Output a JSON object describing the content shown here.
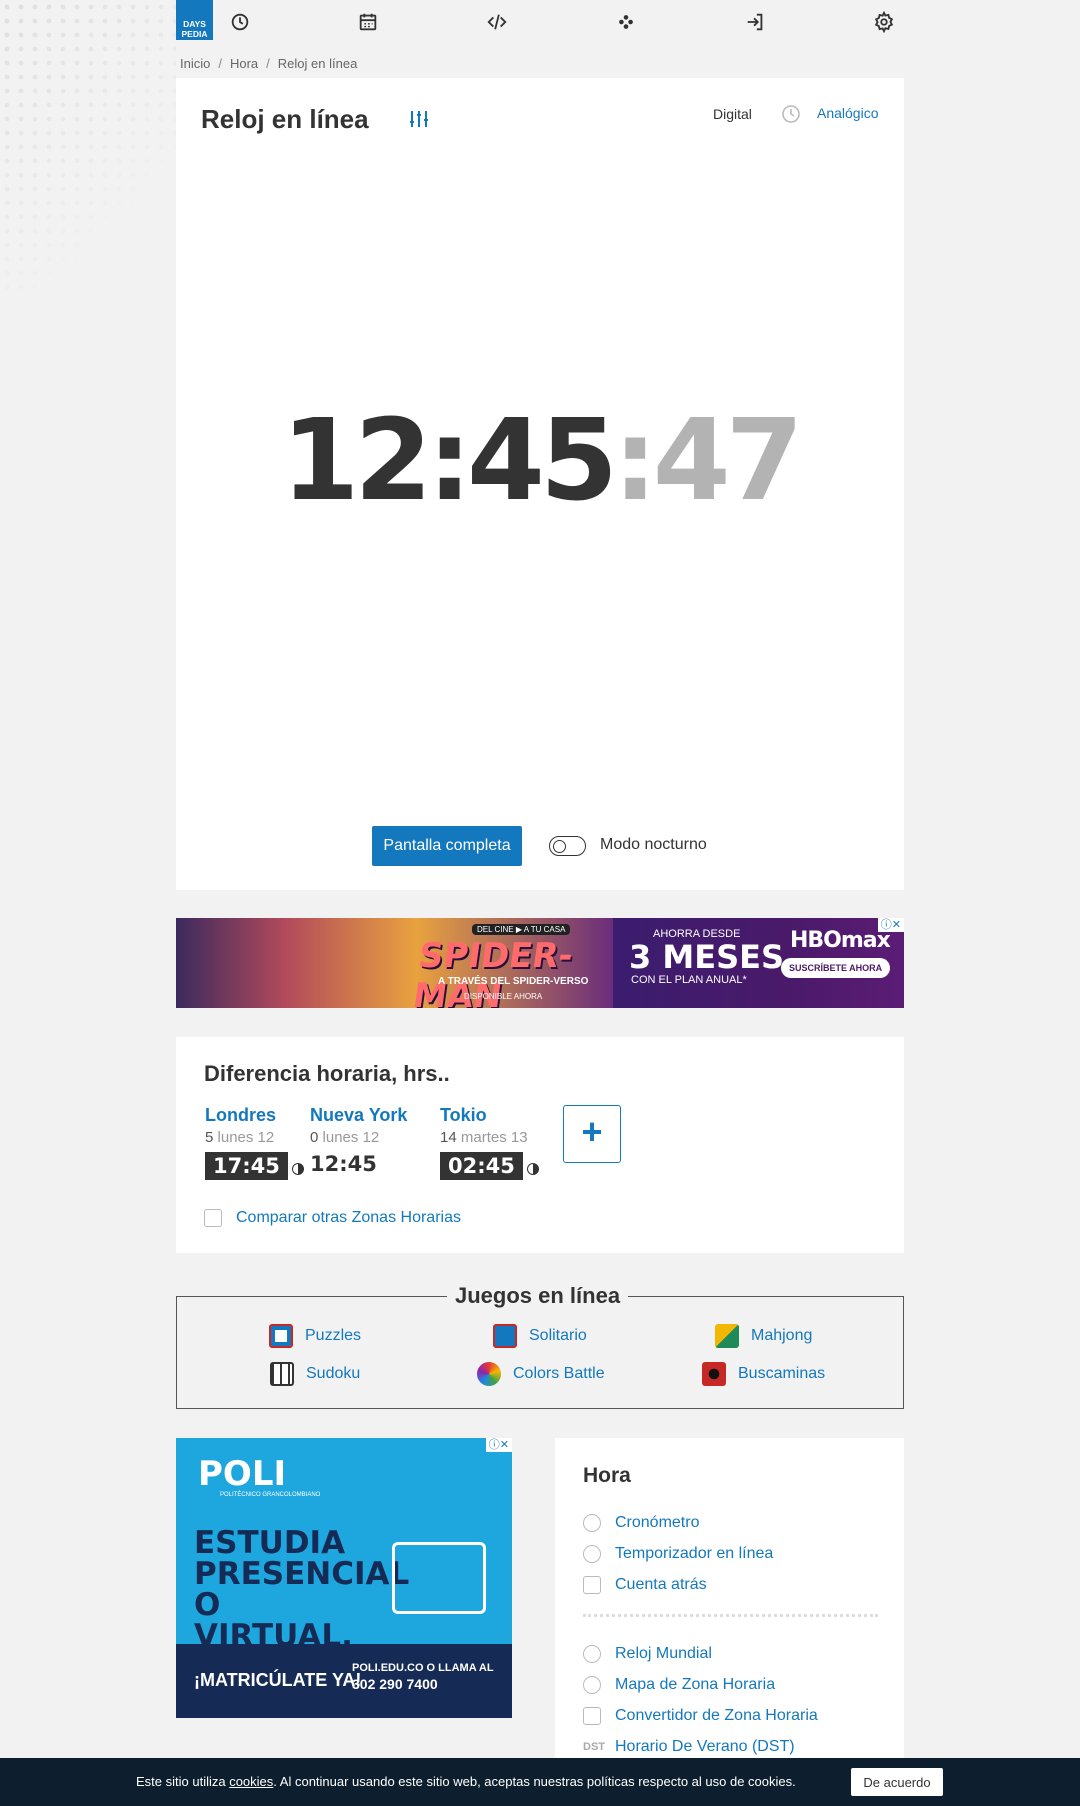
{
  "logo": {
    "line1": "DAYS",
    "line2": "PEDIA"
  },
  "nav_icons": [
    "clock-icon",
    "calendar-icon",
    "code-icon",
    "games-icon",
    "login-icon",
    "gear-icon"
  ],
  "breadcrumb": [
    "Inicio",
    "Hora",
    "Reloj en línea"
  ],
  "clock": {
    "title": "Reloj en línea",
    "mode_digital": "Digital",
    "mode_analog": "Analógico",
    "hours_minutes": "12:45",
    "seconds": ":47",
    "fullscreen_label": "Pantalla completa",
    "night_mode_label": "Modo nocturno",
    "night_mode_on": false
  },
  "ad1": {
    "badge": "DEL CINE ▶ A TU CASA",
    "headline": "SPIDER-MAN",
    "subtitle": "A TRAVÉS DEL SPIDER-VERSO",
    "available": "DISPONIBLE AHORA",
    "promo_small": "AHORRA DESDE",
    "promo_big": "3 MESES",
    "promo_plan": "CON EL PLAN ANUAL*",
    "brand": "HBOmax",
    "cta": "SUSCRÍBETE AHORA"
  },
  "time_diff": {
    "title": "Diferencia horaria, hrs..",
    "cities": [
      {
        "name": "Londres",
        "offset": "5",
        "day": "lunes 12",
        "time": "17:45",
        "dark": true
      },
      {
        "name": "Nueva York",
        "offset": "0",
        "day": "lunes 12",
        "time": "12:45",
        "dark": false
      },
      {
        "name": "Tokio",
        "offset": "14",
        "day": "martes 13",
        "time": "02:45",
        "dark": true
      }
    ],
    "add_label": "+",
    "compare_label": "Comparar otras Zonas Horarias"
  },
  "games": {
    "title": "Juegos en línea",
    "items": [
      "Puzzles",
      "Solitario",
      "Mahjong",
      "Sudoku",
      "Colors Battle",
      "Buscaminas"
    ]
  },
  "ad2": {
    "brand": "POLI",
    "brand_sub": "POLITÉCNICO GRANCOLOMBIANO",
    "headline": "ESTUDIA PRESENCIAL O VIRTUAL.",
    "cta": "¡MATRICÚLATE YA!",
    "contact_line1": "POLI.EDU.CO O LLAMA AL",
    "contact_phone": "302 290 7400"
  },
  "hora": {
    "title": "Hora",
    "items_top": [
      "Cronómetro",
      "Temporizador en línea",
      "Cuenta atrás"
    ],
    "items_bottom": [
      "Reloj Mundial",
      "Mapa de Zona Horaria",
      "Convertidor de Zona Horaria",
      "Horario De Verano (DST)"
    ],
    "dst_badge": "DST"
  },
  "cookie": {
    "text_before": "Este sitio utiliza ",
    "link": "cookies",
    "text_after": ". Al continuar usando este sitio web, aceptas nuestras políticas respecto al uso de cookies.",
    "button": "De acuerdo"
  },
  "colors": {
    "accent": "#1478be",
    "dark": "#333333",
    "cookie_bg": "#0d1f2e"
  }
}
